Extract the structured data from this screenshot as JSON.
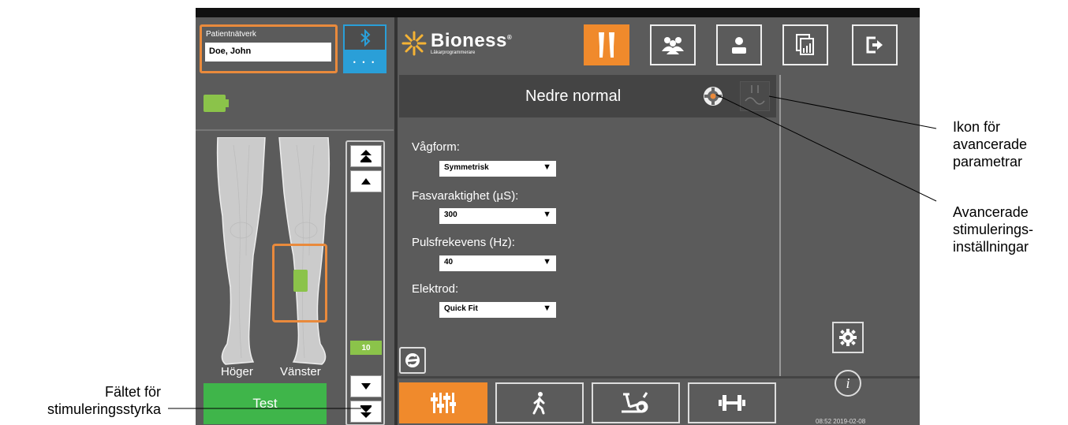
{
  "patient": {
    "label": "Patientnätverk",
    "name": "Doe, John"
  },
  "bluetooth": {
    "icon": "bluetooth-icon",
    "dots": "• • •"
  },
  "battery": {
    "icon": "battery-icon",
    "color": "#8bc34a"
  },
  "legs": {
    "right_label": "Höger",
    "left_label": "Vänster"
  },
  "test_button": "Test",
  "intensity": {
    "value": "10",
    "buttons": [
      "fast-up",
      "up",
      "down",
      "fast-down"
    ]
  },
  "brand": {
    "name": "Bioness",
    "trademark": "®",
    "subtitle": "Läkarprogrammerare"
  },
  "top_nav": [
    {
      "icon": "legs-icon",
      "active": true
    },
    {
      "icon": "group-icon",
      "active": false
    },
    {
      "icon": "user-icon",
      "active": false
    },
    {
      "icon": "report-icon",
      "active": false
    },
    {
      "icon": "exit-icon",
      "active": false
    }
  ],
  "program": {
    "title": "Nedre normal"
  },
  "fields": {
    "waveform": {
      "label": "Vågform:",
      "value": "Symmetrisk"
    },
    "phase_duration": {
      "label": "Fasvaraktighet (µS):",
      "value": "300"
    },
    "pulse_rate": {
      "label": "Pulsfrekevens (Hz):",
      "value": "40"
    },
    "electrode": {
      "label": "Elektrod:",
      "value": "Quick Fit"
    }
  },
  "bottom_nav": [
    {
      "icon": "sliders-icon",
      "active": true
    },
    {
      "icon": "walk-icon",
      "active": false
    },
    {
      "icon": "bike-icon",
      "active": false
    },
    {
      "icon": "dumbbell-icon",
      "active": false
    }
  ],
  "clock": "08:52 2019-02-08",
  "info": "i",
  "callouts": {
    "adv_params": [
      "Ikon för",
      "avancerade",
      "parametrar"
    ],
    "adv_stim": [
      "Avancerade",
      "stimulerings-",
      "inställningar"
    ],
    "intensity": [
      "Fältet för",
      "stimuleringsstyrka"
    ]
  },
  "colors": {
    "accent": "#f08a2c",
    "green": "#3fb54a",
    "bluetooth": "#2a9fd8",
    "screen_bg": "#5b5b5b"
  }
}
